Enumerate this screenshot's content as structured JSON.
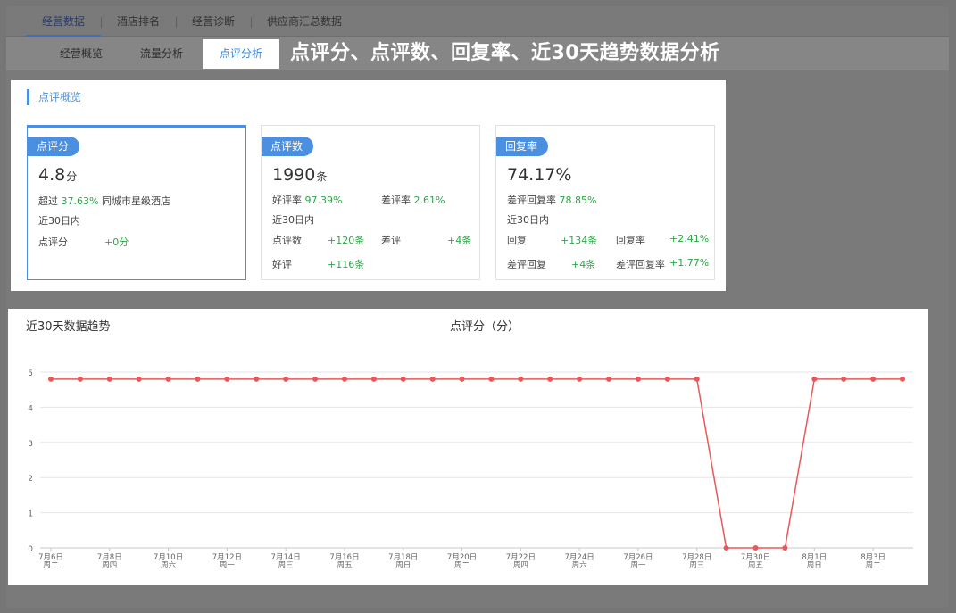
{
  "top_tabs": [
    "经营数据",
    "酒店排名",
    "经营诊断",
    "供应商汇总数据"
  ],
  "sub_tabs": [
    "经营概览",
    "流量分析",
    "点评分析"
  ],
  "headline": "点评分、点评数、回复率、近30天趋势数据分析",
  "overview_title": "点评概览",
  "cards": {
    "score": {
      "badge": "点评分",
      "value": "4.8",
      "unit": "分",
      "beat_prefix": "超过",
      "beat_pct": "37.63%",
      "beat_suffix": "同城市星级酒店",
      "period": "近30日内",
      "row_label": "点评分",
      "row_value": "+0分"
    },
    "count": {
      "badge": "点评数",
      "value": "1990",
      "unit": "条",
      "good_label": "好评率",
      "good_value": "97.39%",
      "bad_label": "差评率",
      "bad_value": "2.61%",
      "period": "近30日内",
      "r1_label": "点评数",
      "r1_value": "+120条",
      "r2_label": "差评",
      "r2_value": "+4条",
      "r3_label": "好评",
      "r3_value": "+116条"
    },
    "reply": {
      "badge": "回复率",
      "value": "74.17%",
      "neg_label": "差评回复率",
      "neg_value": "78.85%",
      "period": "近30日内",
      "r1_label": "回复",
      "r1_value": "+134条",
      "r2_label": "回复率",
      "r2_value": "+2.41%",
      "r3_label": "差评回复",
      "r3_value": "+4条",
      "r4_label": "差评回复率",
      "r4_value": "+1.77%"
    }
  },
  "trend_title": "近30天数据趋势",
  "colors": {
    "accent": "#4a8fe0",
    "positive": "#29a745",
    "line": "#e8585a"
  },
  "chart_data": {
    "type": "line",
    "title": "点评分（分）",
    "x": [
      "7月6日",
      "7月7日",
      "7月8日",
      "7月9日",
      "7月10日",
      "7月11日",
      "7月12日",
      "7月13日",
      "7月14日",
      "7月15日",
      "7月16日",
      "7月17日",
      "7月18日",
      "7月19日",
      "7月20日",
      "7月21日",
      "7月22日",
      "7月23日",
      "7月24日",
      "7月25日",
      "7月26日",
      "7月27日",
      "7月28日",
      "7月29日",
      "7月30日",
      "7月31日",
      "8月1日",
      "8月2日",
      "8月3日",
      "8月4日"
    ],
    "x_tick_labels": [
      {
        "date": "7月6日",
        "weekday": "周二"
      },
      {
        "date": "7月8日",
        "weekday": "周四"
      },
      {
        "date": "7月10日",
        "weekday": "周六"
      },
      {
        "date": "7月12日",
        "weekday": "周一"
      },
      {
        "date": "7月14日",
        "weekday": "周三"
      },
      {
        "date": "7月16日",
        "weekday": "周五"
      },
      {
        "date": "7月18日",
        "weekday": "周日"
      },
      {
        "date": "7月20日",
        "weekday": "周二"
      },
      {
        "date": "7月22日",
        "weekday": "周四"
      },
      {
        "date": "7月24日",
        "weekday": "周六"
      },
      {
        "date": "7月26日",
        "weekday": "周一"
      },
      {
        "date": "7月28日",
        "weekday": "周三"
      },
      {
        "date": "7月30日",
        "weekday": "周五"
      },
      {
        "date": "8月1日",
        "weekday": "周日"
      },
      {
        "date": "8月3日",
        "weekday": "周二"
      }
    ],
    "series": [
      {
        "values": [
          4.8,
          4.8,
          4.8,
          4.8,
          4.8,
          4.8,
          4.8,
          4.8,
          4.8,
          4.8,
          4.8,
          4.8,
          4.8,
          4.8,
          4.8,
          4.8,
          4.8,
          4.8,
          4.8,
          4.8,
          4.8,
          4.8,
          4.8,
          0,
          0,
          0,
          4.8,
          4.8,
          4.8,
          4.8
        ]
      }
    ],
    "yticks": [
      0,
      1,
      2,
      3,
      4,
      5
    ],
    "ylim": [
      0,
      5
    ],
    "grid": true
  }
}
